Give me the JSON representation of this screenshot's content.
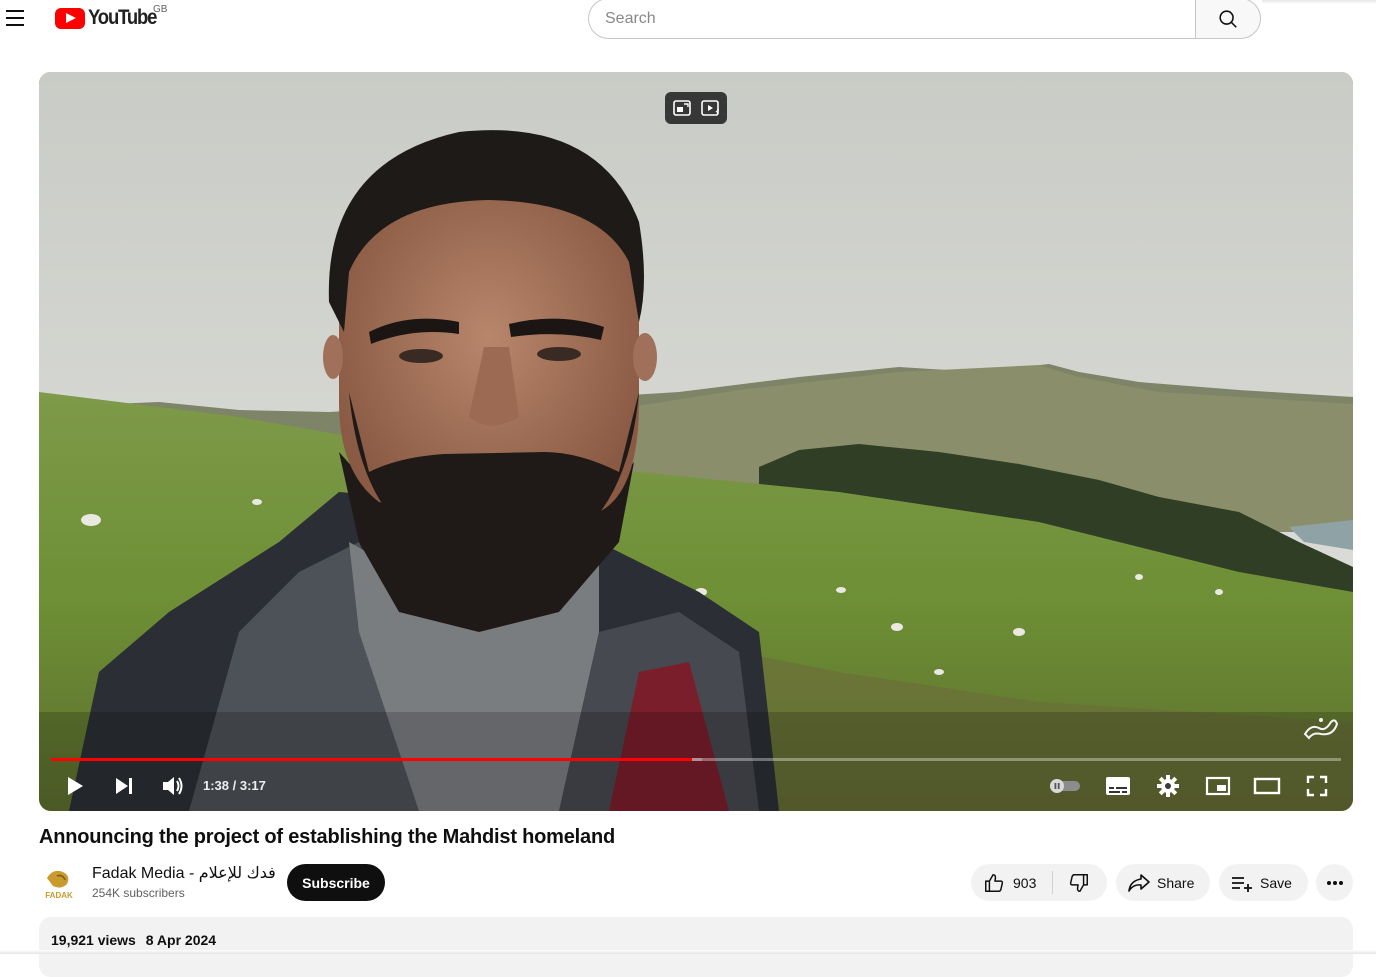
{
  "header": {
    "logo_text": "YouTube",
    "region": "GB",
    "search_placeholder": "Search"
  },
  "player": {
    "current_time": "1:38",
    "duration": "3:17",
    "progress_fraction": 0.497,
    "buffered_fraction": 0.505,
    "accent_color": "#ff0000"
  },
  "video": {
    "title": "Announcing the project of establishing the Mahdist homeland"
  },
  "channel": {
    "name": "Fadak Media - فدك للإعلام",
    "subscribers": "254K subscribers",
    "subscribe_label": "Subscribe",
    "avatar_text": "FADAK"
  },
  "actions": {
    "likes": "903",
    "share_label": "Share",
    "save_label": "Save"
  },
  "description": {
    "views": "19,921 views",
    "date": "8 Apr 2024"
  },
  "icons": [
    "menu-icon",
    "search-icon",
    "play-icon",
    "next-icon",
    "volume-icon",
    "autoplay-toggle",
    "subtitles-icon",
    "settings-icon",
    "miniplayer-icon",
    "theater-icon",
    "fullscreen-icon",
    "like-icon",
    "dislike-icon",
    "share-icon",
    "save-icon",
    "more-icon"
  ]
}
